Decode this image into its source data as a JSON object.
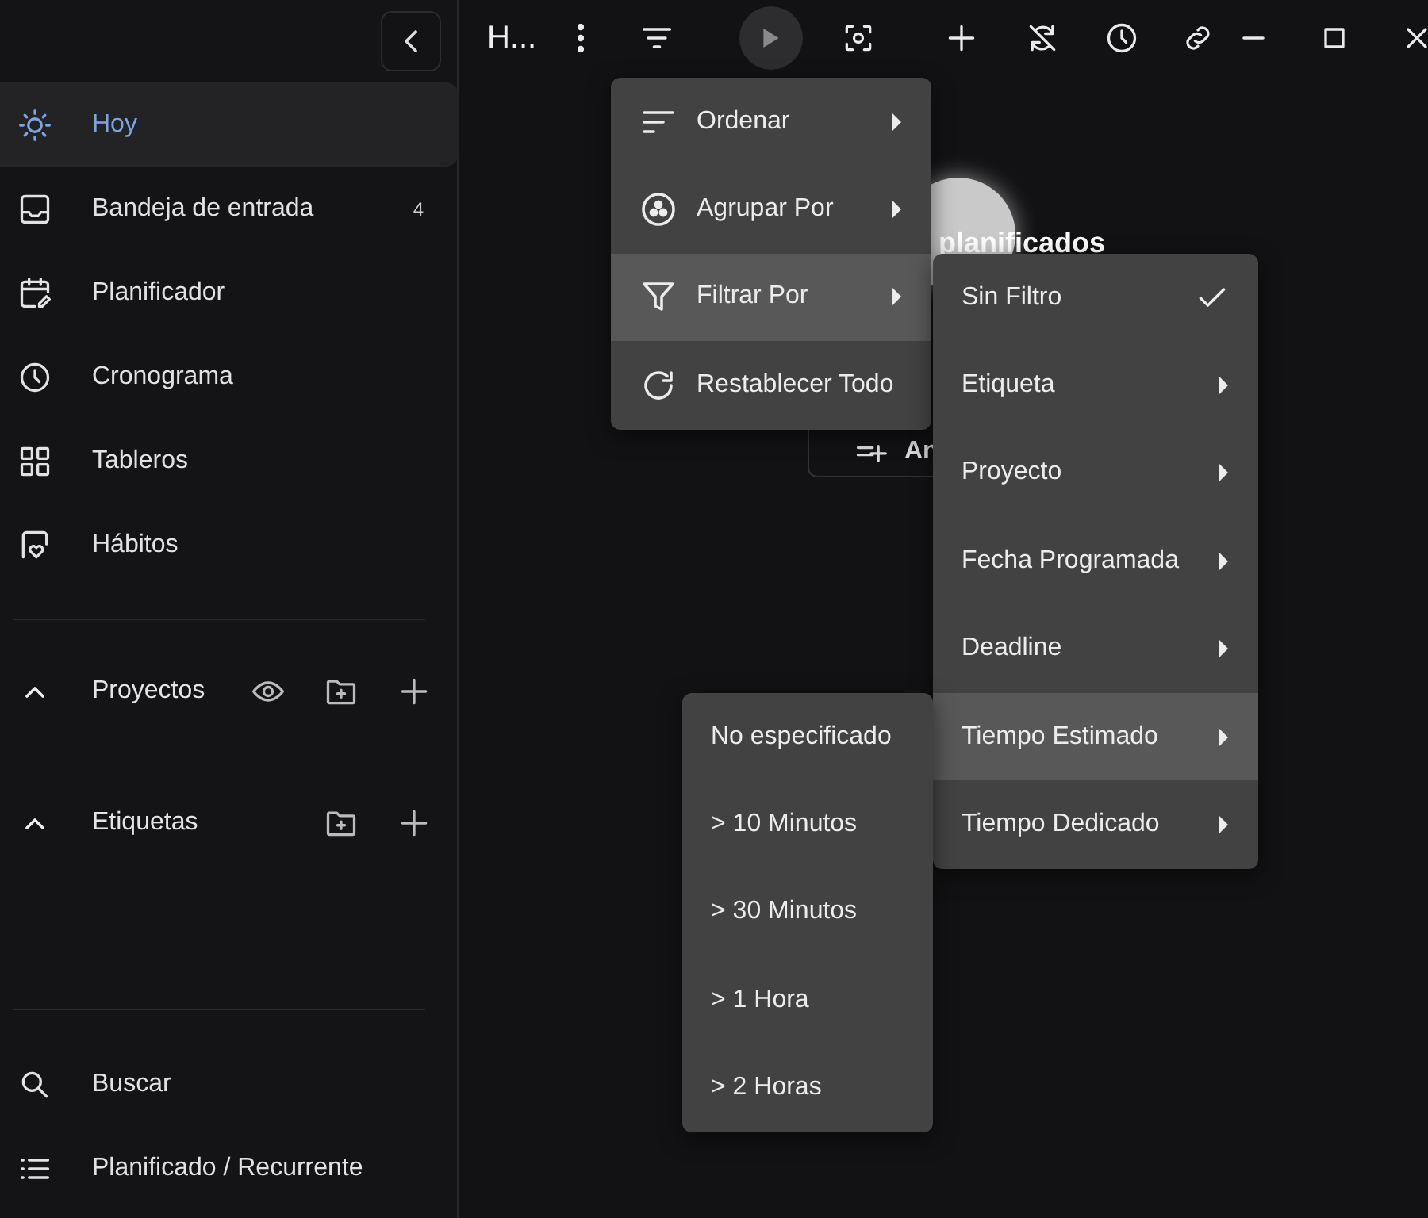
{
  "sidebar": {
    "items": [
      {
        "label": "Hoy",
        "selected": true
      },
      {
        "label": "Bandeja de entrada",
        "selected": false,
        "count": "4"
      },
      {
        "label": "Planificador",
        "selected": false
      },
      {
        "label": "Cronograma",
        "selected": false
      },
      {
        "label": "Tableros",
        "selected": false
      },
      {
        "label": "Hábitos",
        "selected": false
      }
    ],
    "sections": [
      {
        "title": "Proyectos",
        "expanded": true
      },
      {
        "title": "Etiquetas",
        "expanded": true
      }
    ],
    "footer_items": [
      {
        "label": "Buscar"
      },
      {
        "label": "Planificado / Recurrente"
      }
    ]
  },
  "toolbar": {
    "title": "H..."
  },
  "empty_state": {
    "text": "planificados",
    "button": "An"
  },
  "menu": {
    "items": [
      {
        "label": "Ordenar",
        "kind": "submenu",
        "expanded": false
      },
      {
        "label": "Agrupar Por",
        "kind": "submenu",
        "expanded": false
      },
      {
        "label": "Filtrar Por",
        "kind": "submenu",
        "expanded": true
      },
      {
        "label": "Restablecer Todo",
        "kind": "action",
        "expanded": false
      }
    ]
  },
  "filter_menu": {
    "items": [
      {
        "label": "Sin Filtro",
        "kind": "check",
        "checked": true,
        "expanded": false
      },
      {
        "label": "Etiqueta",
        "kind": "submenu",
        "expanded": false
      },
      {
        "label": "Proyecto",
        "kind": "submenu",
        "expanded": false
      },
      {
        "label": "Fecha Programada",
        "kind": "submenu",
        "expanded": false
      },
      {
        "label": "Deadline",
        "kind": "submenu",
        "expanded": false
      },
      {
        "label": "Tiempo Estimado",
        "kind": "submenu",
        "expanded": true
      },
      {
        "label": "Tiempo Dedicado",
        "kind": "submenu",
        "expanded": false
      }
    ]
  },
  "time_menu": {
    "items": [
      {
        "label": "No especificado"
      },
      {
        "label": "> 10 Minutos"
      },
      {
        "label": "> 30 Minutos"
      },
      {
        "label": "> 1 Hora"
      },
      {
        "label": "> 2 Horas"
      }
    ]
  }
}
